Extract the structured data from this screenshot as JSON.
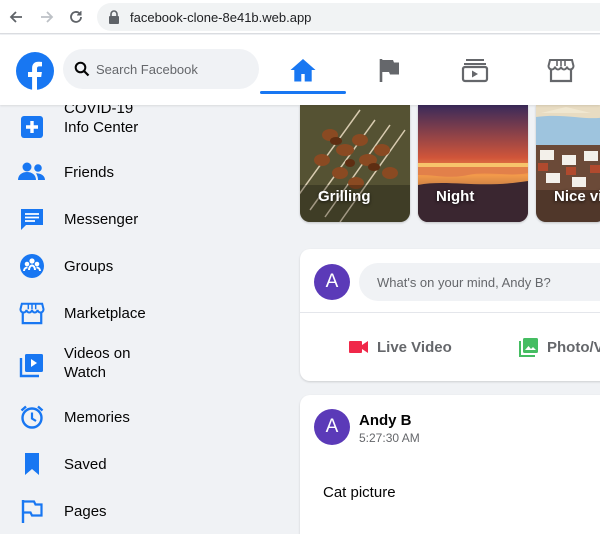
{
  "browser": {
    "url": "facebook-clone-8e41b.web.app"
  },
  "header": {
    "logo_letter": "f",
    "search_placeholder": "Search Facebook",
    "tabs": [
      {
        "name": "home",
        "icon": "home-icon",
        "active": true
      },
      {
        "name": "pages",
        "icon": "flag-icon",
        "active": false
      },
      {
        "name": "watch",
        "icon": "video-icon",
        "active": false
      },
      {
        "name": "marketplace",
        "icon": "store-icon",
        "active": false
      }
    ]
  },
  "sidebar": {
    "items": [
      {
        "label": "COVID-19\nInfo Center",
        "icon": "medical-plus-icon"
      },
      {
        "label": "Friends",
        "icon": "friends-icon"
      },
      {
        "label": "Messenger",
        "icon": "messenger-icon"
      },
      {
        "label": "Groups",
        "icon": "groups-icon"
      },
      {
        "label": "Marketplace",
        "icon": "store-icon"
      },
      {
        "label": "Videos on\nWatch",
        "icon": "video-library-icon"
      },
      {
        "label": "Memories",
        "icon": "alarm-clock-icon"
      },
      {
        "label": "Saved",
        "icon": "bookmark-icon"
      },
      {
        "label": "Pages",
        "icon": "flag-outline-icon"
      }
    ]
  },
  "stories": [
    {
      "label": "Grilling"
    },
    {
      "label": "Night"
    },
    {
      "label": "Nice vi"
    }
  ],
  "composer": {
    "avatar_letter": "A",
    "placeholder": "What's on your mind, Andy B?",
    "actions": [
      {
        "label": "Live Video",
        "icon": "videocam-icon",
        "color": "#f02849"
      },
      {
        "label": "Photo/V",
        "icon": "photo-library-icon",
        "color": "#45bd62"
      }
    ]
  },
  "post": {
    "avatar_letter": "A",
    "author": "Andy B",
    "time": "5:27:30 AM",
    "text": "Cat picture"
  },
  "colors": {
    "brand": "#1877f2",
    "avatar": "#5b3ab8",
    "page_bg": "#f0f2f5"
  }
}
